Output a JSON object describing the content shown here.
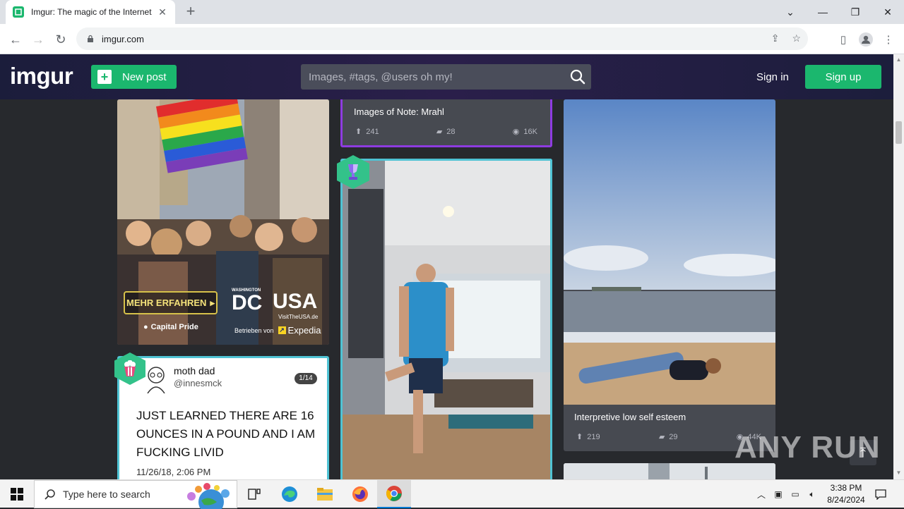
{
  "browser": {
    "tab_title": "Imgur: The magic of the Internet",
    "url": "imgur.com"
  },
  "header": {
    "logo": "imgur",
    "new_post_label": "New post",
    "search_placeholder": "Images, #tags, @users oh my!",
    "sign_in_label": "Sign in",
    "sign_up_label": "Sign up"
  },
  "posts": [
    {
      "ad_cta": "MEHR ERFAHREN",
      "ad_location": "Capital Pride",
      "ad_brand_small": "WASHINGTON",
      "ad_brand_big": "DC",
      "ad_usa": "USA",
      "ad_site": "VisitTheUSA.de",
      "ad_sponsor_prefix": "Betrieben von",
      "ad_sponsor": "Expedia"
    },
    {
      "title": "Images of Note: Mrahl",
      "upvotes": "241",
      "comments": "28",
      "views": "16K"
    },
    {
      "tweet_name": "moth dad",
      "tweet_handle": "@innesmck",
      "tweet_counter": "1/14",
      "tweet_text_1": "JUST LEARNED THERE ARE 16",
      "tweet_text_2": "OUNCES IN A POUND AND I AM",
      "tweet_text_3": "FUCKING LIVID",
      "tweet_date": "11/26/18, 2:06 PM"
    },
    {
      "title": "Interpretive low self esteem",
      "upvotes": "219",
      "comments": "29",
      "views": "44K"
    }
  ],
  "watermark": "ANY RUN",
  "taskbar": {
    "search_placeholder": "Type here to search",
    "time": "3:38 PM",
    "date": "8/24/2024"
  },
  "colors": {
    "accent_green": "#1bb76e",
    "purple_border": "#8e3ce0",
    "teal_border": "#4fc3d4"
  }
}
